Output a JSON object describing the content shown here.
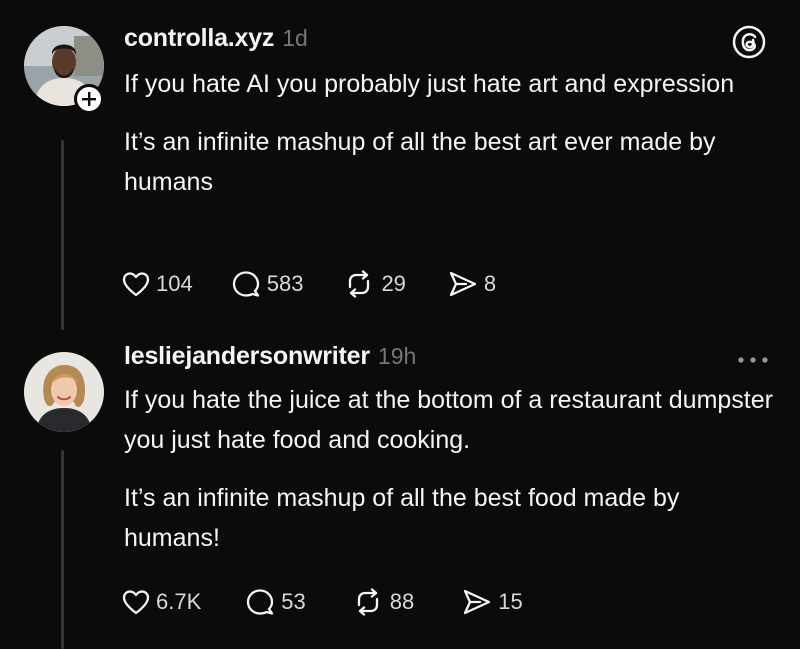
{
  "posts": [
    {
      "username": "controlla.xyz",
      "time": "1d",
      "paragraphs": [
        "If you hate AI you probably just hate art and expression",
        "It’s an infinite mashup of all the best art ever made by humans"
      ],
      "counts": {
        "likes": "104",
        "replies": "583",
        "reposts": "29",
        "shares": "8"
      },
      "avatar_icon": "avatar-man",
      "corner_icon": "threads-logo-icon",
      "follow_badge": "plus-icon"
    },
    {
      "username": "lesliejandersonwriter",
      "time": "19h",
      "paragraphs": [
        "If you hate the juice at the bottom of a restaurant dumpster you just hate food and cooking.",
        "It’s an infinite mashup of all the best food made by humans!"
      ],
      "counts": {
        "likes": "6.7K",
        "replies": "53",
        "reposts": "88",
        "shares": "15"
      },
      "avatar_icon": "avatar-woman",
      "corner_icon": "more-options-icon"
    }
  ],
  "colors": {
    "background": "#0b0b0b",
    "text": "#f3f5f7",
    "muted": "#777777",
    "thread_line": "#333638"
  }
}
